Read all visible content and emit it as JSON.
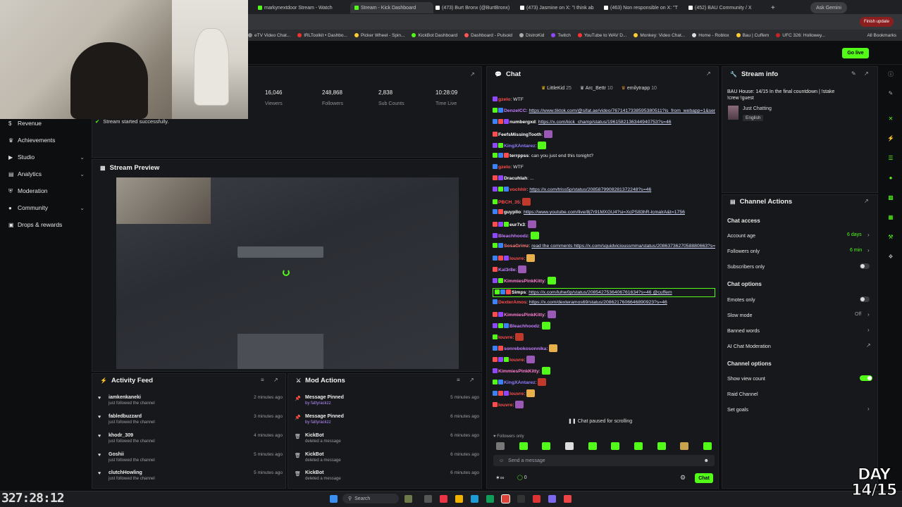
{
  "browser": {
    "tabs": [
      {
        "label": "markynextdoor Stream - Watch"
      },
      {
        "label": "Stream - Kick Dashboard"
      },
      {
        "label": "(473) Burt Bronx (@BurtBronx)"
      },
      {
        "label": "(473) Jasmine on X: \"I think ab"
      },
      {
        "label": "(463) Non responsible on X: \"T"
      },
      {
        "label": "(452) BAU Community / X"
      }
    ],
    "ask_gemini": "Ask Gemini",
    "finish_update": "Finish update",
    "all_bookmarks": "All Bookmarks",
    "bookmarks": [
      "eTV Video Chat...",
      "IRLToolkit • Dashbo...",
      "Picker Wheel - Spin...",
      "KickBot Dashboard",
      "Dashboard - Pulsoid",
      "DistroKid",
      "Twitch",
      "YouTube to WAV D...",
      "Monkey: Video Chat...",
      "Home - Roblox",
      "Bau | Cuffem",
      "UFC 326: Hollowey..."
    ]
  },
  "kick": {
    "go_live": "Go live",
    "toast": "Stream started successfully.",
    "sidebar": [
      {
        "label": "Revenue",
        "icon": "dollar-icon"
      },
      {
        "label": "Achievements",
        "icon": "trophy-icon"
      },
      {
        "label": "Studio",
        "icon": "video-icon",
        "chevron": true
      },
      {
        "label": "Analytics",
        "icon": "chart-icon",
        "chevron": true
      },
      {
        "label": "Moderation",
        "icon": "shield-icon"
      },
      {
        "label": "Community",
        "icon": "people-icon",
        "chevron": true
      },
      {
        "label": "Drops & rewards",
        "icon": "gift-icon"
      }
    ],
    "stats": [
      {
        "value": "16,046",
        "label": "Viewers"
      },
      {
        "value": "248,868",
        "label": "Followers"
      },
      {
        "value": "2,838",
        "label": "Sub Counts"
      },
      {
        "value": "10:28:09",
        "label": "Time Live"
      }
    ],
    "stream_preview": {
      "title": "Stream Preview"
    },
    "activity_feed": {
      "title": "Activity Feed",
      "items": [
        {
          "name": "iamkenkaneki",
          "action": "just followed the channel",
          "time": "2 minutes ago"
        },
        {
          "name": "fabledbuzzard",
          "action": "just followed the channel",
          "time": "3 minutes ago"
        },
        {
          "name": "khodr_309",
          "action": "just followed the channel",
          "time": "4 minutes ago"
        },
        {
          "name": "Goshii",
          "action": "just followed the channel",
          "time": "5 minutes ago"
        },
        {
          "name": "clutchHowling",
          "action": "just followed the channel",
          "time": "5 minutes ago"
        }
      ]
    },
    "mod_actions": {
      "title": "Mod Actions",
      "items": [
        {
          "title": "Message Pinned",
          "sub": "by fattyrackzz",
          "time": "5 minutes ago",
          "icon": "pin-icon"
        },
        {
          "title": "Message Pinned",
          "sub": "by fattyrackzz",
          "time": "6 minutes ago",
          "icon": "pin-icon"
        },
        {
          "title": "KickBot",
          "sub": "deleted a message",
          "time": "6 minutes ago",
          "icon": "trash-icon"
        },
        {
          "title": "KickBot",
          "sub": "deleted a message",
          "time": "6 minutes ago",
          "icon": "trash-icon"
        },
        {
          "title": "KickBot",
          "sub": "deleted a message",
          "time": "6 minutes ago",
          "icon": "trash-icon"
        }
      ]
    },
    "chat": {
      "title": "Chat",
      "top_gifters": [
        {
          "name": "LittleKid",
          "count": "25"
        },
        {
          "name": "Arc_Bettr",
          "count": "10"
        },
        {
          "name": "emilytrapp",
          "count": "10"
        }
      ],
      "messages": [
        {
          "user": "gzelo",
          "text": "WTF",
          "color": "#ff4d4d"
        },
        {
          "user": "DenzelCC",
          "text": "https://www.tiktok.com/@sifat.ae/video/7671417338595380511?is_from_webapp=1&sender_device=pc&web_id=7612557446442475732",
          "color": "#c37dff",
          "link": true
        },
        {
          "user": "numbergxd",
          "text": "https://x.com/kick_champ/status/1961582136344940753?s=46",
          "color": "#ffffff",
          "link": true
        },
        {
          "user": "FeefsMissingTooth",
          "text": "",
          "color": "#ffffff"
        },
        {
          "user": "KingXAntarez",
          "text": "",
          "color": "#8f7dff"
        },
        {
          "user": "terrppss",
          "text": "can you just end this tonight?",
          "color": "#ffffff"
        },
        {
          "user": "gzelo",
          "text": "WTF",
          "color": "#ff4d4d"
        },
        {
          "user": "Dracuhlah",
          "text": "...",
          "color": "#ffffff"
        },
        {
          "user": "vochhlr",
          "text": "https://x.com/triss5p/status/2085879908281372248?s=46",
          "color": "#ff4d4d",
          "link": true
        },
        {
          "user": "PBCH_35",
          "text": "",
          "color": "#ff4d4d"
        },
        {
          "user": "guypllo",
          "text": "https://www.youtube.com/live/8j7r91MXGU4?si=XcPS83hR-lcmalrA&t=1756",
          "color": "#ffffff",
          "link": true
        },
        {
          "user": "eur7x3",
          "text": "",
          "color": "#ffffff"
        },
        {
          "user": "Bleachhoodz",
          "text": "",
          "color": "#c37dff"
        },
        {
          "user": "SosaGrimz",
          "text": "read the comments https://x.com/squidvicioussmma/status/2086373627058880663?s=46",
          "color": "#ff7d7d",
          "link": true
        },
        {
          "user": "louvre",
          "text": "",
          "color": "#ff4d4d"
        },
        {
          "user": "Kal3r8e",
          "text": "",
          "color": "#c37dff"
        },
        {
          "user": "KimmiesPinkKitty",
          "text": "",
          "color": "#ff7dd2"
        },
        {
          "user": "Simps",
          "text": "https://x.com/luhw0p/status/2085427536406761634?s=46 @cuffem",
          "color": "#ffffff",
          "link": true,
          "pinned": true
        },
        {
          "user": "DexterAmos",
          "text": "https://x.com/dexteramos69/status/2086217606646890923?s=46",
          "color": "#ff4d4d",
          "link": true
        },
        {
          "user": "KimmiesPinkKitty",
          "text": "",
          "color": "#ff7dd2"
        },
        {
          "user": "Bleachhoodz",
          "text": "",
          "color": "#c37dff"
        },
        {
          "user": "louvre",
          "text": "",
          "color": "#ff4d4d"
        },
        {
          "user": "sonrebokosonnika",
          "text": "",
          "color": "#c37dff"
        },
        {
          "user": "louvre",
          "text": "",
          "color": "#ff4d4d"
        },
        {
          "user": "KimmiesPinkKitty",
          "text": "",
          "color": "#ff7dd2"
        },
        {
          "user": "KingXAntarez",
          "text": "",
          "color": "#8f7dff"
        },
        {
          "user": "louvre",
          "text": "",
          "color": "#ff4d4d"
        },
        {
          "user": "louvre",
          "text": "",
          "color": "#ff4d4d"
        }
      ],
      "paused": "Chat paused for scrolling",
      "followers_only": "Followers only",
      "input_placeholder": "Send a message",
      "points": "0",
      "send": "Chat"
    },
    "stream_info": {
      "title": "Stream info",
      "stream_title": "BAU House: 14/15 In the final countdown | !stake !crew !guest",
      "category": "Just Chatting",
      "language": "English"
    },
    "channel_actions": {
      "title": "Channel Actions",
      "chat_access": "Chat access",
      "account_age": {
        "label": "Account age",
        "value": "6 days"
      },
      "followers_only": {
        "label": "Followers only",
        "value": "6 min"
      },
      "subscribers_only": {
        "label": "Subscribers only",
        "on": false
      },
      "chat_options": "Chat options",
      "emotes_only": {
        "label": "Emotes only",
        "on": false
      },
      "slow_mode": {
        "label": "Slow mode",
        "value": "Off"
      },
      "banned_words": "Banned words",
      "ai_moderation": "AI Chat Moderation",
      "channel_options": "Channel options",
      "show_view_count": {
        "label": "Show view count",
        "on": true
      },
      "raid_channel": "Raid Channel",
      "set_goals": "Set goals"
    }
  },
  "overlay": {
    "timer": "327:28:12",
    "day_line1": "DAY",
    "day_line2": "14/15"
  },
  "taskbar": {
    "search": "Search"
  },
  "colors": {
    "kick_green": "#53fc18",
    "panel": "#17181b",
    "background": "#0d0e10"
  }
}
